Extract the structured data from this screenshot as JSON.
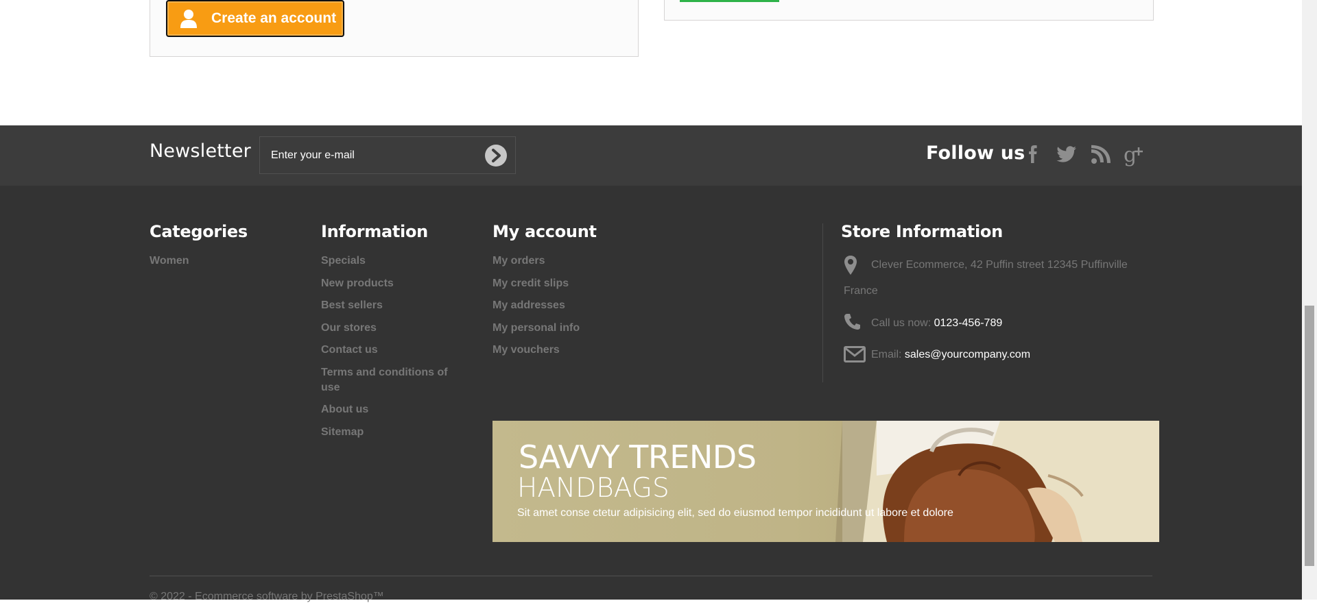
{
  "login": {
    "create_account_label": "Create an account",
    "create_account_icon": "user-icon"
  },
  "colors": {
    "accent_orange": "#f89c13",
    "footer_bg": "#333333",
    "footer_top_bg": "#3c3c3c",
    "link_gray": "#777777",
    "green_bar": "#2fb34a"
  },
  "newsletter": {
    "title": "Newsletter",
    "placeholder": "Enter your e-mail",
    "submit_icon": "chevron-right-circle-icon"
  },
  "follow": {
    "title": "Follow us",
    "icons": [
      "facebook-icon",
      "twitter-icon",
      "rss-icon",
      "google-plus-icon"
    ]
  },
  "categories": {
    "title": "Categories",
    "items": [
      "Women"
    ]
  },
  "information": {
    "title": "Information",
    "items": [
      "Specials",
      "New products",
      "Best sellers",
      "Our stores",
      "Contact us",
      "Terms and conditions of use",
      "About us",
      "Sitemap"
    ]
  },
  "my_account": {
    "title": "My account",
    "items": [
      "My orders",
      "My credit slips",
      "My addresses",
      "My personal info",
      "My vouchers"
    ]
  },
  "store": {
    "title": "Store Information",
    "address": "Clever Ecommerce, 42 Puffin street 12345 Puffinville France",
    "call_label": "Call us now:",
    "phone": "0123-456-789",
    "email_label": "Email:",
    "email": "sales@yourcompany.com"
  },
  "banner": {
    "title_line1": "SAVVY TRENDS",
    "title_line2": "HANDBAGS",
    "description": "Sit amet conse ctetur adipisicing elit, sed do eiusmod tempor incididunt ut labore et dolore"
  },
  "copyright": "© 2022 - Ecommerce software by PrestaShop™"
}
